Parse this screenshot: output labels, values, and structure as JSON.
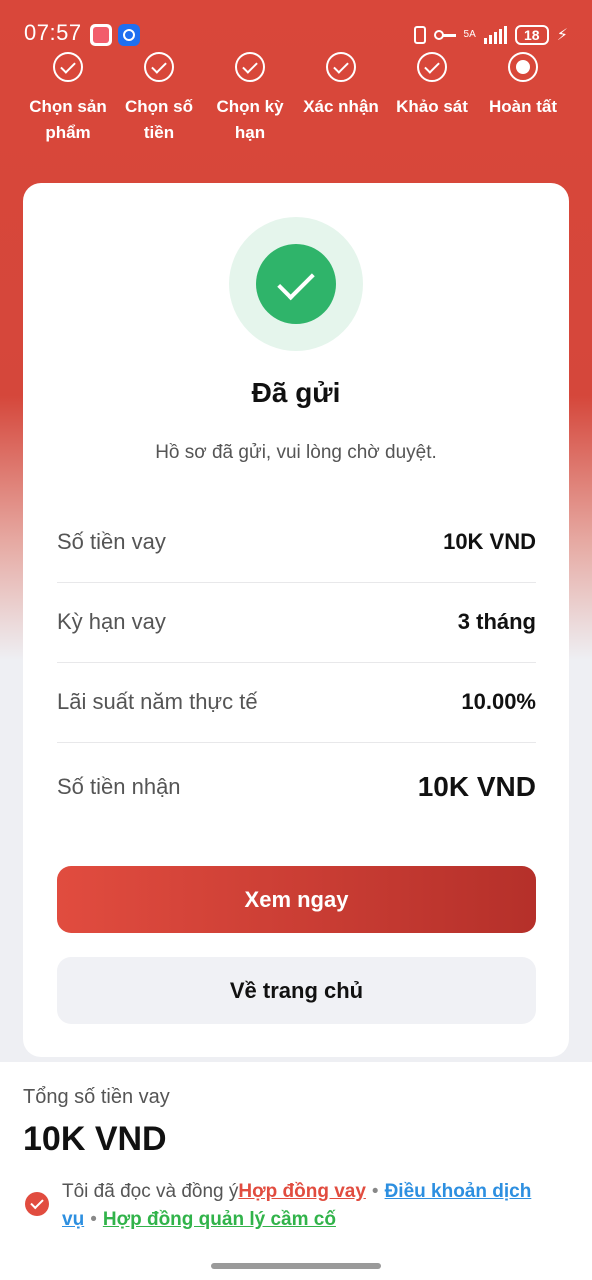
{
  "status_bar": {
    "time": "07:57",
    "network": "5A",
    "battery": "18"
  },
  "steps": [
    {
      "label": "Chọn sản phẩm",
      "state": "done"
    },
    {
      "label": "Chọn số tiền",
      "state": "done"
    },
    {
      "label": "Chọn kỳ hạn",
      "state": "done"
    },
    {
      "label": "Xác nhận",
      "state": "done"
    },
    {
      "label": "Khảo sát",
      "state": "done"
    },
    {
      "label": "Hoàn tất",
      "state": "current"
    }
  ],
  "card": {
    "title": "Đã gửi",
    "subtitle": "Hồ sơ đã gửi, vui lòng chờ duyệt.",
    "rows": [
      {
        "label": "Số tiền vay",
        "value": "10K VND"
      },
      {
        "label": "Kỳ hạn vay",
        "value": "3 tháng"
      },
      {
        "label": "Lãi suất năm thực tế",
        "value": "10.00%"
      },
      {
        "label": "Số tiền nhận",
        "value": "10K VND"
      }
    ],
    "primary_button": "Xem ngay",
    "secondary_button": "Về trang chủ"
  },
  "bottom": {
    "total_label": "Tổng số tiền vay",
    "total_value": "10K VND",
    "agree_prefix": "Tôi đã đọc và đồng ý",
    "links": {
      "loan_contract": "Hợp đồng vay",
      "terms": "Điều khoản dịch vụ",
      "pawn_contract": "Hợp đồng quản lý cầm cố"
    },
    "separator": "•"
  },
  "colors": {
    "brand_red": "#e14c3f",
    "success_green": "#2fb46a",
    "link_blue": "#2d8fe0",
    "link_green": "#31b34a"
  }
}
